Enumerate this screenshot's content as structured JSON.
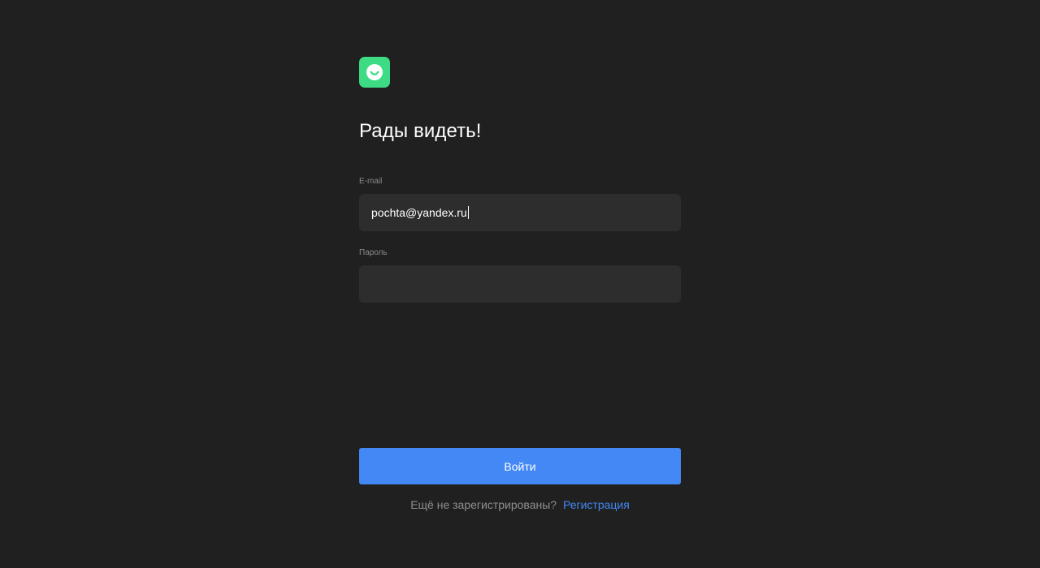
{
  "app": {
    "logo_icon": "smile-icon",
    "logo_color": "#3ddc84"
  },
  "login": {
    "title": "Рады видеть!",
    "email": {
      "label": "E-mail",
      "value": "pochta@yandex.ru"
    },
    "password": {
      "label": "Пароль",
      "value": ""
    },
    "submit_label": "Войти",
    "register_prompt": "Ещё не зарегистрированы?",
    "register_link": "Регистрация"
  },
  "colors": {
    "background": "#202020",
    "field": "#2d2d2d",
    "accent": "#4388f5"
  }
}
